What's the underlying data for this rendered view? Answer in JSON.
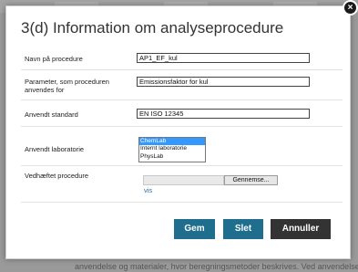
{
  "background": {
    "footer_text": "anvendelse og materialer, hvor beregningsmetoder beskrives. Ved anvendelse af"
  },
  "dialog": {
    "title": "3(d) Information om analyseprocedure",
    "close_symbol": "×",
    "fields": {
      "name": {
        "label": "Navn på procedure",
        "value": "AP1_EF_kul"
      },
      "parameter": {
        "label": "Parameter, som proceduren anvendes for",
        "value": "Emissionsfaktor for kul"
      },
      "standard": {
        "label": "Anvendt standard",
        "value": "EN ISO 12345"
      },
      "laboratory": {
        "label": "Anvendt laboratorie",
        "options": [
          "ChemLab",
          "Internt laboratorie",
          "PhysLab"
        ],
        "selected": "ChemLab"
      },
      "attachment": {
        "label": "Vedhæftet procedure",
        "browse_label": "Gennemse...",
        "link_label": "vis"
      }
    },
    "buttons": {
      "save": "Gem",
      "delete": "Slet",
      "cancel": "Annuller"
    }
  },
  "colors": {
    "primary_button": "#1f6e8e",
    "cancel_button": "#333333",
    "link": "#2a6fa8",
    "selection": "#3399ff"
  }
}
